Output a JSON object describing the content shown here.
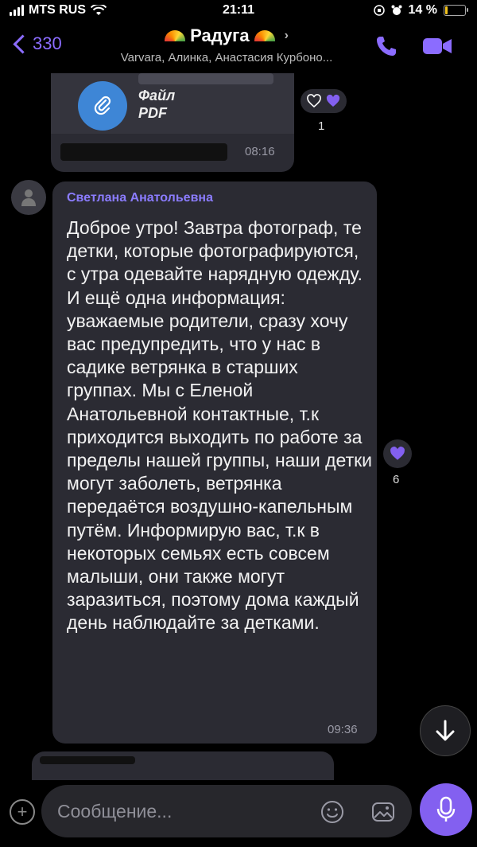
{
  "status_bar": {
    "carrier": "MTS RUS",
    "time": "21:11",
    "battery": "14 %",
    "battery_level": 0.14
  },
  "header": {
    "back_count": "330",
    "title": "Радуга",
    "subtitle": "Varvara, Алинка, Анастасия Курбоно..."
  },
  "messages": [
    {
      "file_type": "Файл",
      "file_ext": "PDF",
      "time": "08:16",
      "reaction_count": "1"
    },
    {
      "sender": "Светлана Анатольевна",
      "text": "Доброе утро! Завтра фотограф, те детки, которые фотографируются, с утра одевайте нарядную одежду. И ещё одна информация: уважаемые родители, сразу хочу вас предупредить, что у нас в садике ветрянка в старших группах. Мы с Еленой Анатольевной контактные, т.к приходится выходить по работе за пределы нашей группы, наши детки могут заболеть, ветрянка передаётся воздушно-капельным путём. Информирую вас, т.к в некоторых семьях есть совсем малыши, они также могут заразиться, поэтому дома каждый день наблюдайте за детками.",
      "time": "09:36",
      "reaction_count": "6"
    }
  ],
  "input": {
    "placeholder": "Сообщение..."
  },
  "colors": {
    "accent": "#8360f0",
    "sender": "#8b7cff",
    "bubble": "#2b2b33"
  }
}
